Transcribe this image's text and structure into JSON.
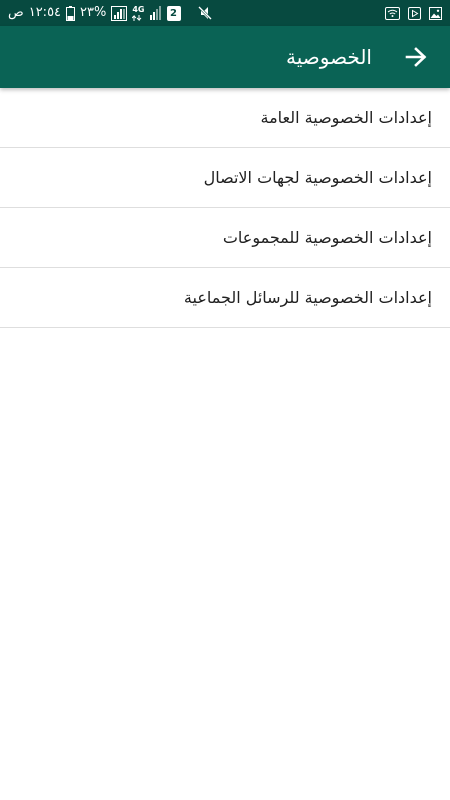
{
  "status_bar": {
    "ampm": "ص",
    "time": "١٢:٥٤",
    "battery_percent": "٢٣%",
    "network_type": "4G",
    "sim_slot": "2"
  },
  "app_bar": {
    "title": "الخصوصية",
    "back_icon": "arrow-back-icon"
  },
  "menu": {
    "items": [
      {
        "label": "إعدادات الخصوصية العامة"
      },
      {
        "label": "إعدادات الخصوصية لجهات الاتصال"
      },
      {
        "label": "إعدادات الخصوصية للمجموعات"
      },
      {
        "label": "إعدادات الخصوصية للرسائل الجماعية"
      }
    ]
  },
  "colors": {
    "status_bar_bg": "#074a40",
    "app_bar_bg": "#0a6355",
    "divider": "#dedede",
    "text_primary": "#212121"
  }
}
